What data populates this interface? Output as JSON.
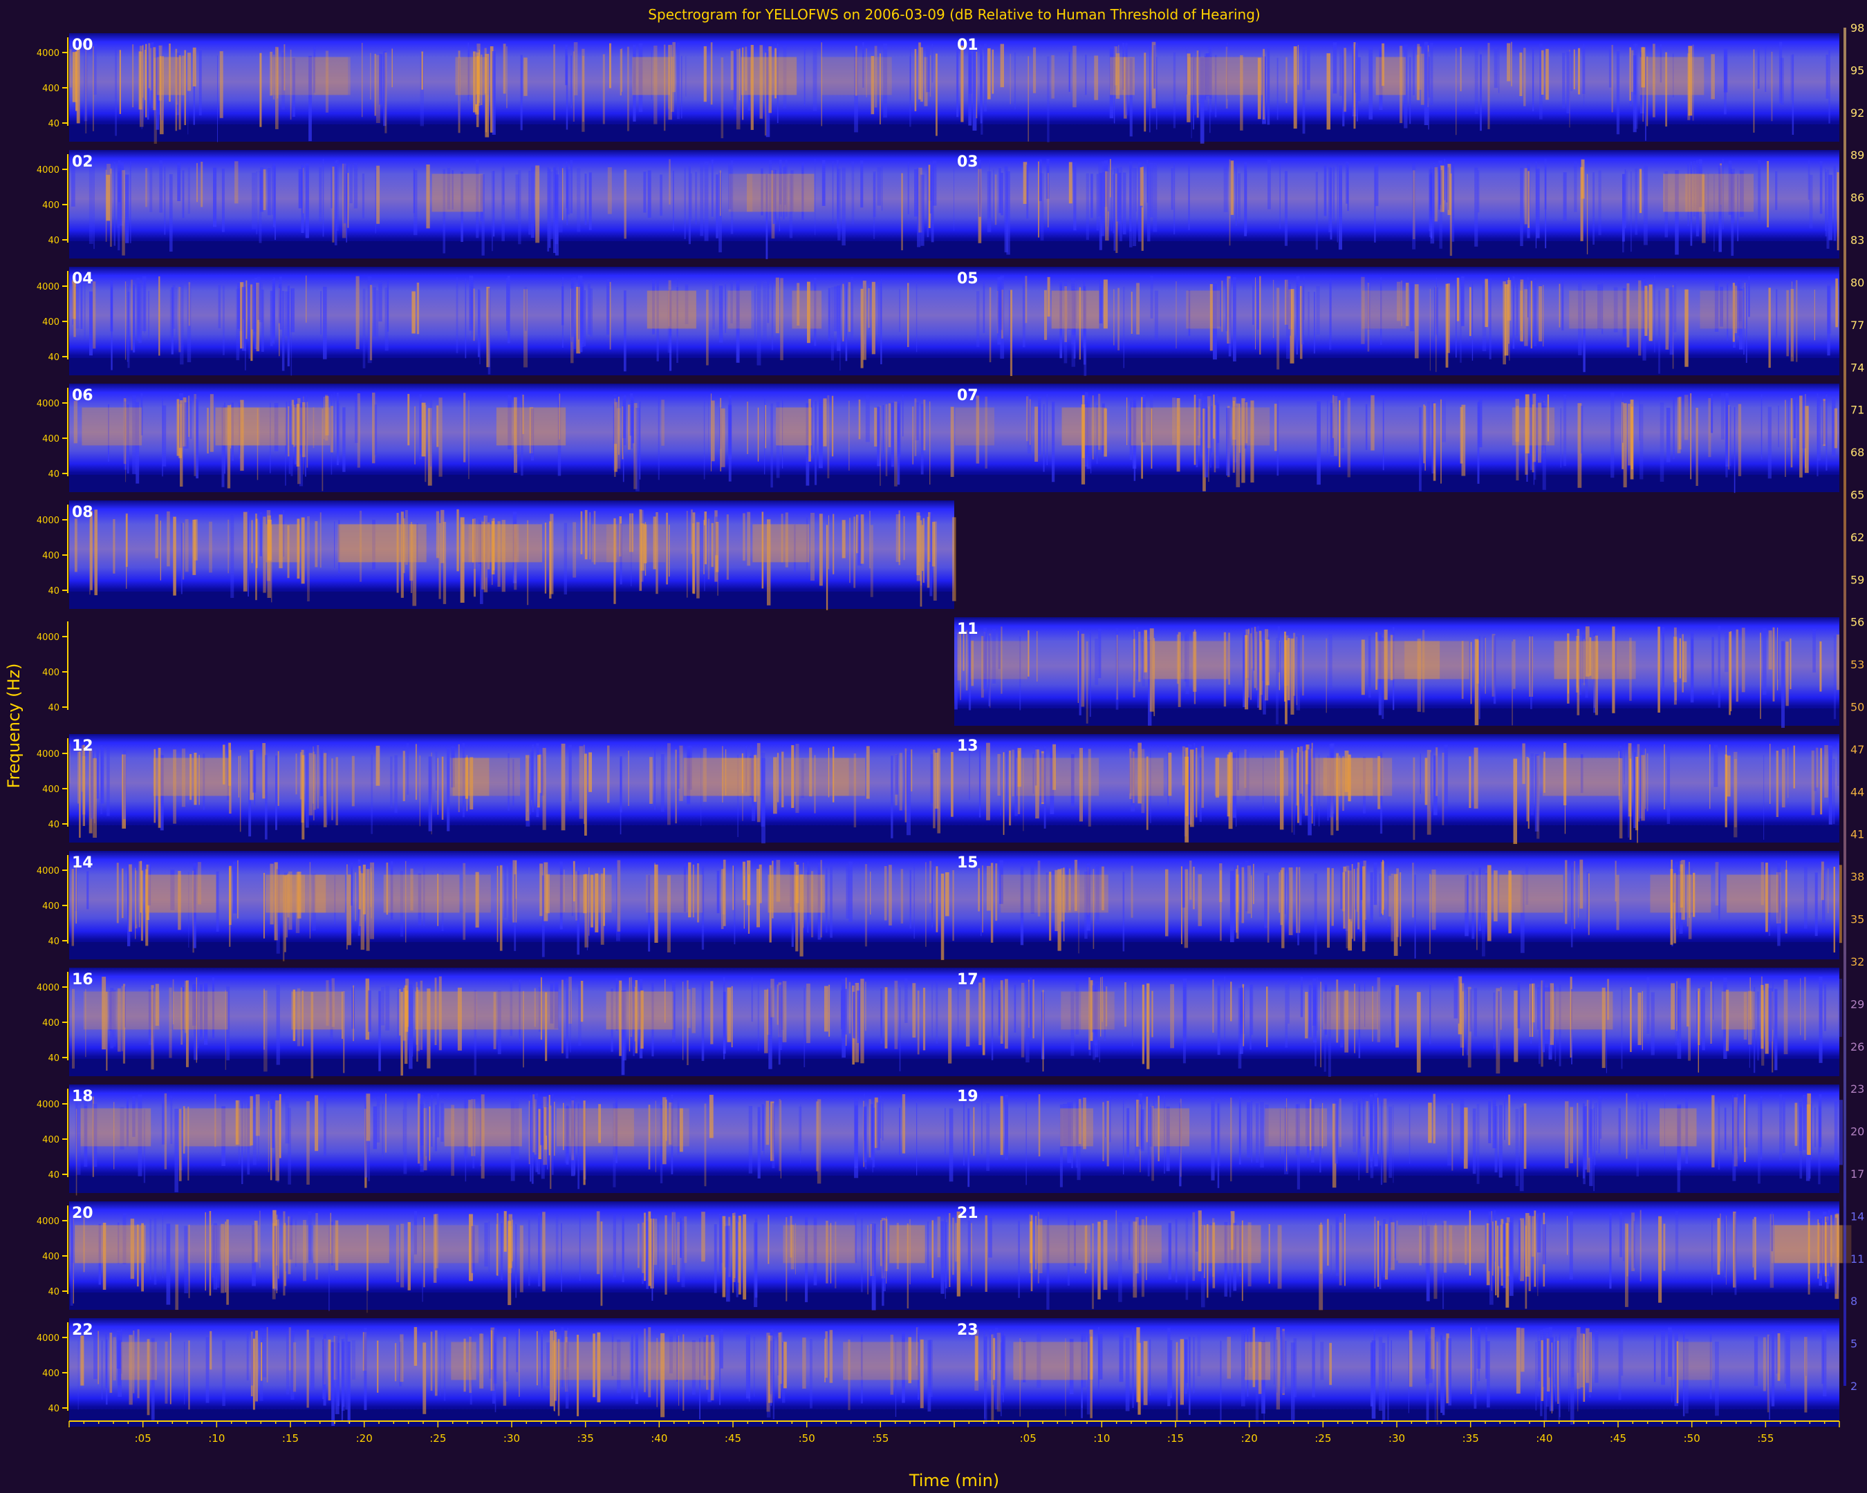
{
  "chart_data": {
    "type": "heatmap",
    "title": "Spectrogram for YELLOFWS on 2006-03-09 (dB Relative to Human Threshold of Hearing)",
    "xlabel": "Time (min)",
    "ylabel": "Frequency (Hz)",
    "hour_labels": [
      "00",
      "01",
      "02",
      "03",
      "04",
      "05",
      "06",
      "07",
      "08",
      "11",
      "12",
      "13",
      "14",
      "15",
      "16",
      "17",
      "18",
      "19",
      "20",
      "21",
      "22",
      "23"
    ],
    "hours_present": [
      0,
      1,
      2,
      3,
      4,
      5,
      6,
      7,
      8,
      11,
      12,
      13,
      14,
      15,
      16,
      17,
      18,
      19,
      20,
      21,
      22,
      23
    ],
    "hours_missing": [
      9,
      10
    ],
    "y_ticks": [
      "4000",
      "400",
      "40"
    ],
    "x_ticks": [
      ":05",
      ":10",
      ":15",
      ":20",
      ":25",
      ":30",
      ":35",
      ":40",
      ":45",
      ":50",
      ":55"
    ],
    "colorbar": {
      "labels": [
        98,
        95,
        92,
        89,
        86,
        83,
        80,
        77,
        74,
        71,
        68,
        65,
        62,
        59,
        56,
        53,
        50,
        47,
        44,
        41,
        38,
        35,
        32,
        29,
        26,
        23,
        20,
        17,
        14,
        11,
        8,
        5,
        2
      ],
      "colors": [
        "#ffd27a",
        "#e89a3a",
        "#b07c9a",
        "#5a5ad8",
        "#2222ff",
        "#0a0a9a"
      ]
    },
    "activity": {
      "00": 0.62,
      "01": 0.35,
      "02": 0.22,
      "03": 0.18,
      "04": 0.26,
      "05": 0.4,
      "06": 0.5,
      "07": 0.45,
      "08": 0.78,
      "11": 0.62,
      "12": 0.58,
      "13": 0.6,
      "14": 0.72,
      "15": 0.6,
      "16": 0.5,
      "17": 0.42,
      "18": 0.4,
      "19": 0.32,
      "20": 0.55,
      "21": 0.6,
      "22": 0.45,
      "23": 0.25
    }
  }
}
